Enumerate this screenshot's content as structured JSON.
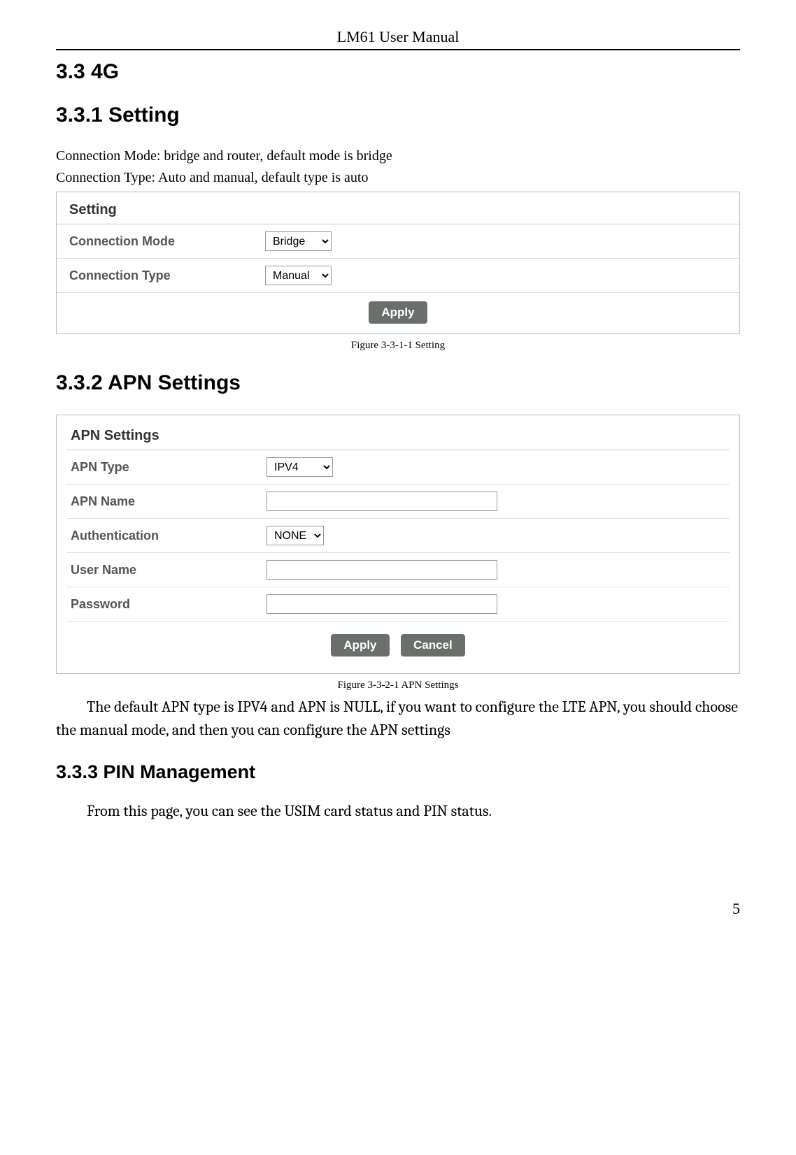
{
  "header": {
    "title": "LM61 User Manual"
  },
  "sections": {
    "s33_title": "3.3 4G",
    "s331_title": "3.3.1 Setting",
    "s331_p1": "Connection Mode: bridge and router, default mode is bridge",
    "s331_p2": "Connection Type: Auto and manual, default type is auto",
    "setting_panel": {
      "title": "Setting",
      "rows": {
        "conn_mode_label": "Connection Mode",
        "conn_mode_value": "Bridge",
        "conn_type_label": "Connection Type",
        "conn_type_value": "Manual"
      },
      "apply_label": "Apply",
      "figcap": "Figure 3-3-1-1 Setting"
    },
    "s332_title": "3.3.2 APN Settings",
    "apn_panel": {
      "title": "APN Settings",
      "rows": {
        "apn_type_label": "APN Type",
        "apn_type_value": "IPV4",
        "apn_name_label": "APN Name",
        "apn_name_value": "",
        "auth_label": "Authentication",
        "auth_value": "NONE",
        "user_label": "User Name",
        "user_value": "",
        "pass_label": "Password",
        "pass_value": ""
      },
      "apply_label": "Apply",
      "cancel_label": "Cancel",
      "figcap": "Figure 3-3-2-1 APN Settings"
    },
    "s332_desc": "The default APN type is IPV4 and APN is NULL, if you want to configure the LTE APN, you should choose the manual mode, and then you can configure the APN settings",
    "s333_title": "3.3.3 PIN Management",
    "s333_p1": "From this page, you can see the USIM card status and PIN status."
  },
  "page_number": "5"
}
